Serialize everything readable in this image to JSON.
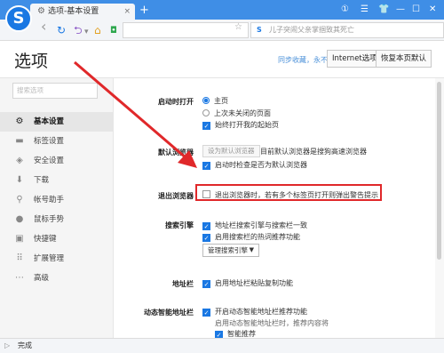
{
  "browser": {
    "logo_letter": "S",
    "tab_title": "选项-基本设置",
    "tab_close": "×",
    "new_tab": "+",
    "window_controls": [
      "①",
      "☰",
      "👕",
      "—",
      "☐",
      "✕"
    ],
    "nav": {
      "back": "‹",
      "refresh": "↻",
      "undo": "⮌",
      "dropdown": "▾",
      "home": "⌂"
    },
    "address_value": "",
    "address_star": "☆",
    "search_prefix": "S",
    "search_placeholder": "儿子突闹父亲掌掴致其死亡",
    "status_text": "完成"
  },
  "header": {
    "title": "选项",
    "sync_link": "同步收藏，永不丢失",
    "internet_options": "Internet选项",
    "restore_defaults": "恢复本页默认"
  },
  "sidebar": {
    "search_placeholder": "搜索选项",
    "items": [
      {
        "label": "基本设置",
        "icon": "⚙",
        "active": true
      },
      {
        "label": "标签设置",
        "icon": "▬",
        "active": false
      },
      {
        "label": "安全设置",
        "icon": "◈",
        "active": false
      },
      {
        "label": "下载",
        "icon": "⬇",
        "active": false
      },
      {
        "label": "帐号助手",
        "icon": "⚲",
        "active": false
      },
      {
        "label": "鼠标手势",
        "icon": "●",
        "active": false
      },
      {
        "label": "快捷键",
        "icon": "▣",
        "active": false
      },
      {
        "label": "扩展管理",
        "icon": "⠿",
        "active": false
      },
      {
        "label": "高级",
        "icon": "⋯",
        "active": false
      }
    ]
  },
  "settings": {
    "startup": {
      "label": "启动时打开",
      "options": [
        "主页",
        "上次未关闭的页面",
        "始终打开我的起始页"
      ]
    },
    "default_browser": {
      "label": "默认浏览器",
      "button": "设为默认浏览器",
      "status": "目前默认浏览器是搜狗高速浏览器",
      "check_on_start": "启动时检查是否为默认浏览器"
    },
    "exit_browser": {
      "label": "退出浏览器",
      "warn_multiple_tabs": "退出浏览器时，若有多个标签页打开则弹出警告提示"
    },
    "search_engine": {
      "label": "搜索引擎",
      "sync_addr": "地址栏搜索引擎与搜索栏一致",
      "enable_hot_search": "启用搜索栏的热词推荐功能",
      "manage_button": "管理搜索引擎"
    },
    "address_bar": {
      "label": "地址栏",
      "paste_copy": "启用地址栏粘贴复制功能"
    },
    "smart_address": {
      "label": "动态智能地址栏",
      "enable": "开启动态智能地址栏推荐功能",
      "sub_text": "启用动态智能地址栏时，推荐内容将",
      "smart_rec": "智能推荐"
    }
  }
}
